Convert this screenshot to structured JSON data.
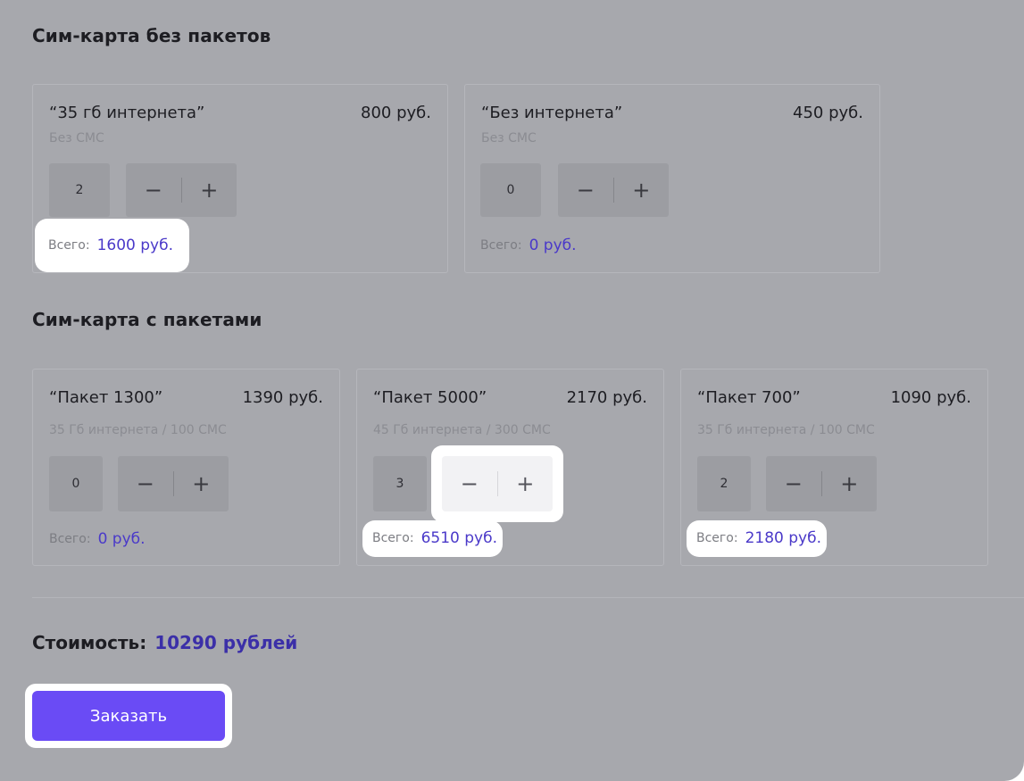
{
  "sections": {
    "no_packages": {
      "title": "Сим-карта без пакетов",
      "cards": [
        {
          "name": "“35 гб интернета”",
          "price": "800 руб.",
          "desc": "Без СМС",
          "qty": "2",
          "total_label": "Всего:",
          "total": "1600 руб."
        },
        {
          "name": "“Без интернета”",
          "price": "450 руб.",
          "desc": "Без СМС",
          "qty": "0",
          "total_label": "Всего:",
          "total": "0 руб."
        }
      ]
    },
    "with_packages": {
      "title": "Сим-карта с пакетами",
      "cards": [
        {
          "name": "“Пакет 1300”",
          "price": "1390 руб.",
          "desc": "35 Гб интернета / 100 СМС",
          "qty": "0",
          "total_label": "Всего:",
          "total": "0 руб."
        },
        {
          "name": "“Пакет 5000”",
          "price": "2170 руб.",
          "desc": "45 Гб интернета / 300 СМС",
          "qty": "3",
          "total_label": "Всего:",
          "total": "6510 руб."
        },
        {
          "name": "“Пакет 700”",
          "price": "1090 руб.",
          "desc": "35 Гб интернета / 100 СМС",
          "qty": "2",
          "total_label": "Всего:",
          "total": "2180 руб."
        }
      ]
    }
  },
  "stepper": {
    "minus": "−",
    "plus": "+"
  },
  "summary": {
    "cost_label": "Стоимость:",
    "cost_value": "10290 рублей"
  },
  "order_button": "Заказать",
  "colors": {
    "accent": "#6a4bf5",
    "price_accent": "#4a39c9",
    "overlay": "#a7a8ad"
  }
}
